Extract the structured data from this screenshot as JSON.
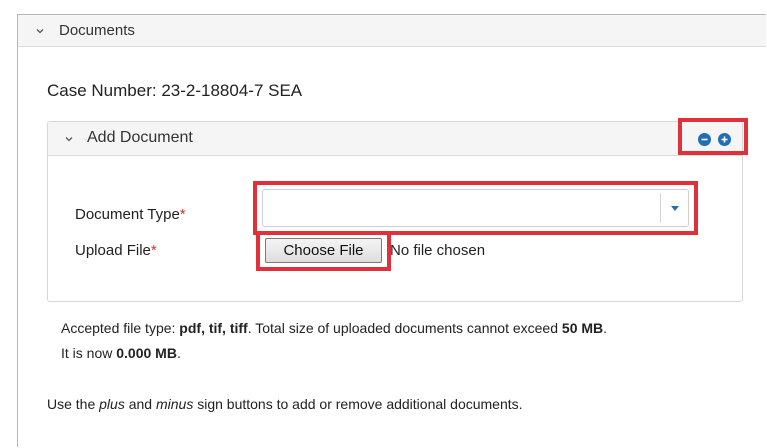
{
  "documents_section": {
    "title": "Documents",
    "case_number": "Case Number: 23-2-18804-7 SEA",
    "add_document": {
      "title": "Add Document",
      "document_type_label": "Document Type",
      "upload_file_label": "Upload File",
      "required_marker": "*",
      "document_type_value": "",
      "choose_file_label": "Choose File",
      "no_file_text": "No file chosen"
    },
    "accepted_prefix": "Accepted file type: ",
    "accepted_types": "pdf, tif, tiff",
    "accepted_mid": ". Total size of uploaded documents cannot exceed ",
    "max_size": "50 MB",
    "accepted_after_max": ".",
    "now_prefix": "It is now ",
    "current_size": "0.000 MB",
    "now_suffix": ".",
    "note_prefix": "Use the ",
    "note_plus": "plus",
    "note_and": " and ",
    "note_minus": "minus",
    "note_suffix": " sign buttons to add or remove additional documents."
  },
  "icons": {
    "collapse": "chevron-down-icon",
    "remove": "minus-circle-icon",
    "add": "plus-circle-icon"
  },
  "colors": {
    "accent": "#1f6fb2",
    "required": "#c0392b",
    "highlight": "#e0313b",
    "header_bg": "#f5f5f5"
  }
}
